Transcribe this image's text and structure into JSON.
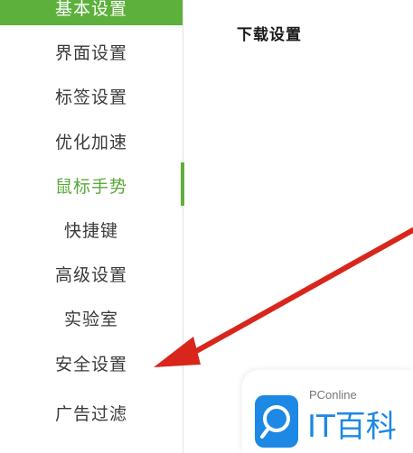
{
  "sidebar": {
    "active_item": "基本设置",
    "items": [
      {
        "label": "界面设置"
      },
      {
        "label": "标签设置"
      },
      {
        "label": "优化加速"
      },
      {
        "label": "鼠标手势"
      },
      {
        "label": "快捷键"
      },
      {
        "label": "高级设置"
      },
      {
        "label": "实验室"
      },
      {
        "label": "安全设置"
      },
      {
        "label": "广告过滤"
      }
    ]
  },
  "main": {
    "title": "下载设置"
  },
  "watermark": {
    "brand_small": "PConline",
    "brand_large": "IT百科"
  },
  "colors": {
    "accent_green": "#5cb03b",
    "arrow_red": "#d9261c",
    "watermark_blue": "#1e88e5"
  }
}
